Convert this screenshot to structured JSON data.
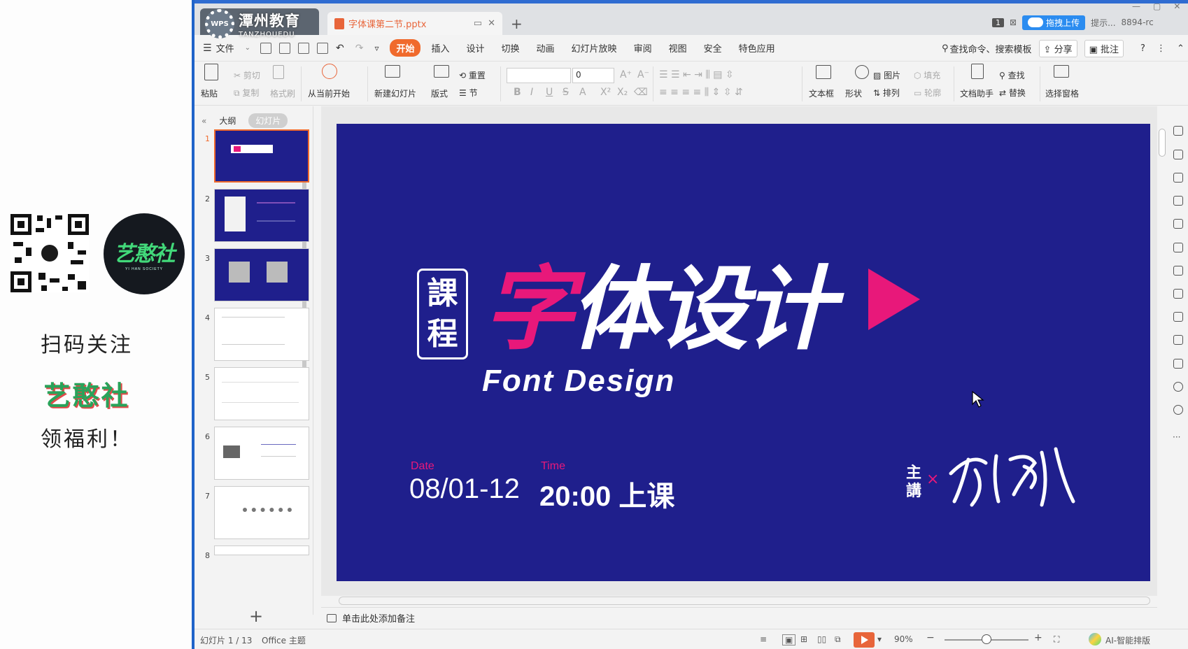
{
  "promo": {
    "line1": "扫码关注",
    "line2": "艺憨社",
    "line3": "领福利！",
    "logo_big": "艺憨社",
    "logo_small": "YI HAN SOCIETY"
  },
  "titlebar": {
    "watermark_cn": "潭州教育",
    "watermark_en": "TANZHOUEDU",
    "app_tab": "WPS",
    "file_tab": "字体课第二节.pptx",
    "upload_label": "拖拽上传",
    "right_text": "提示...",
    "right_code": "8894-rc",
    "badge": "1"
  },
  "menu": {
    "file": "文件",
    "items": [
      "开始",
      "插入",
      "设计",
      "切换",
      "动画",
      "幻灯片放映",
      "审阅",
      "视图",
      "安全",
      "特色应用"
    ],
    "active": "开始",
    "search": "查找命令、搜索模板",
    "share": "分享",
    "comment": "批注"
  },
  "ribbon": {
    "paste": "粘贴",
    "cut": "剪切",
    "copy": "复制",
    "format_painter": "格式刷",
    "from_current": "从当前开始",
    "new_slide": "新建幻灯片",
    "layout": "版式",
    "reset": "重置",
    "section": "节",
    "font_size": "0",
    "textbox": "文本框",
    "shape": "形状",
    "picture": "图片",
    "fill": "填充",
    "arrange": "排列",
    "outline": "轮廓",
    "doc_assistant": "文档助手",
    "find": "查找",
    "replace": "替换",
    "select_pane": "选择窗格"
  },
  "pane": {
    "outline_tab": "大纲",
    "slides_tab": "幻灯片",
    "thumbs": [
      "1",
      "2",
      "3",
      "4",
      "5",
      "6",
      "7",
      "8"
    ],
    "selected": "1"
  },
  "slide": {
    "badge_top": "課",
    "badge_bottom": "程",
    "title_a": "字",
    "title_b": "体",
    "title_c": "设计",
    "subtitle": "Font Design",
    "date_label": "Date",
    "date_value": "08/01-12",
    "time_label": "Time",
    "time_value": "20:00 上课",
    "host_label": "主講"
  },
  "notes": {
    "placeholder": "单击此处添加备注"
  },
  "status": {
    "slide_info": "幻灯片 1 / 13",
    "theme": "Office 主题",
    "zoom": "90%",
    "ai_label": "AI-智能排版"
  },
  "colors": {
    "slide_bg": "#1f1f8c",
    "accent_pink": "#e8187a",
    "menu_active": "#f06a2c",
    "promo_green": "#29a35a"
  }
}
